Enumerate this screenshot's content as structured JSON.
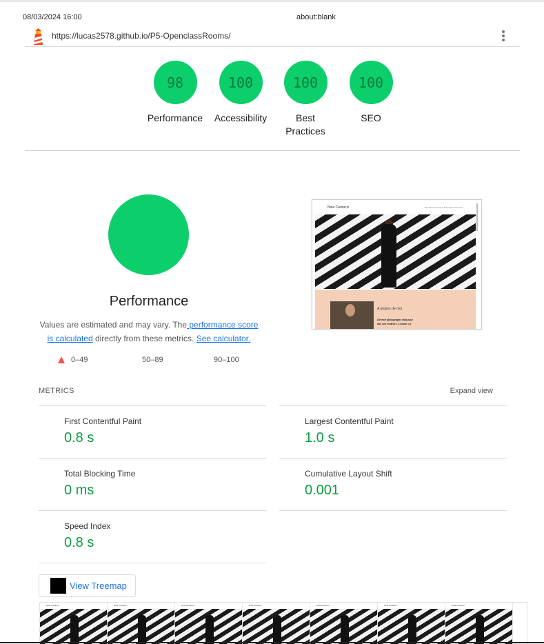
{
  "print_header": {
    "date": "08/03/2024 16:00",
    "title": "about:blank"
  },
  "url_bar": {
    "url": "https://lucas2578.github.io/P5-OpenclassRooms/",
    "logo_icon": "lighthouse-icon",
    "menu_icon": "kebab-menu-icon"
  },
  "gauges": [
    {
      "score": "98",
      "label": "Performance"
    },
    {
      "score": "100",
      "label": "Accessibility"
    },
    {
      "score": "100",
      "label": "Best Practices"
    },
    {
      "score": "100",
      "label": "SEO"
    }
  ],
  "performance": {
    "title": "Performance",
    "desc_prefix": "Values are estimated and may vary. The",
    "link_score": " performance score is calculated",
    "desc_middle": " directly from these metrics. ",
    "link_calc": "See calculator.",
    "legend": {
      "fail": "0–49",
      "average": "50–89",
      "pass": "90–100"
    }
  },
  "screenshot": {
    "site_name": "Nina Carducci",
    "nav": "Accueil  Services  Portfolio  Contact",
    "about_title": "A propos de moi",
    "about_line1": "Devenir photographe était pour",
    "about_line2": "moi une évidence. Comme si j'"
  },
  "metrics": {
    "header": "METRICS",
    "expand": "Expand view",
    "items": [
      {
        "label": "First Contentful Paint",
        "value": "0.8 s"
      },
      {
        "label": "Largest Contentful Paint",
        "value": "1.0 s"
      },
      {
        "label": "Total Blocking Time",
        "value": "0 ms"
      },
      {
        "label": "Cumulative Layout Shift",
        "value": "0.001"
      },
      {
        "label": "Speed Index",
        "value": "0.8 s"
      }
    ]
  },
  "treemap": {
    "label": "View Treemap"
  },
  "filmstrip": {
    "frame_site_name": "Nina Carducci"
  },
  "colors": {
    "pass_green": "#0cce6b",
    "score_text": "#0a7a3e",
    "metric_value": "#0c9c41",
    "link_blue": "#1a73e8",
    "fail_red": "#ff4e42",
    "average_orange": "#ffa400"
  }
}
